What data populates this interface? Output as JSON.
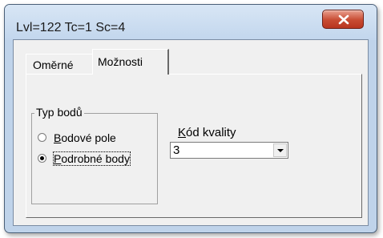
{
  "window": {
    "title": "Lvl=122 Tc=1 Sc=4"
  },
  "tabs": [
    {
      "label": "Oměrné",
      "active": false
    },
    {
      "label": "Možnosti",
      "active": true
    }
  ],
  "group": {
    "label": "Typ bodů",
    "options": [
      {
        "access_key": "B",
        "rest": "odové pole",
        "checked": false
      },
      {
        "access_key": "P",
        "rest": "odrobné body",
        "checked": true
      }
    ]
  },
  "quality": {
    "access_key": "K",
    "rest": "ód kvality",
    "value": "3"
  },
  "icons": {
    "close": "close-icon",
    "dropdown": "chevron-down-icon"
  },
  "colors": {
    "close_button": "#c84b32",
    "frame": "#bfd3ea",
    "client": "#f0f0f0"
  }
}
